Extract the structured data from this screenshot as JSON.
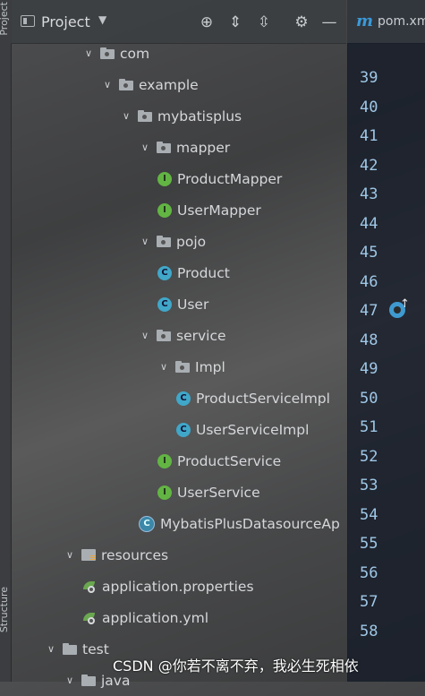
{
  "sidebar": {
    "top_label": "Project",
    "bottom_label": "Structure"
  },
  "project_panel": {
    "title": "Project"
  },
  "editor_tab": {
    "label": "pom.xml"
  },
  "tree": [
    {
      "label": "com",
      "kind": "package",
      "expanded": true
    },
    {
      "label": "example",
      "kind": "package",
      "expanded": true
    },
    {
      "label": "mybatisplus",
      "kind": "package",
      "expanded": true
    },
    {
      "label": "mapper",
      "kind": "package",
      "expanded": true
    },
    {
      "label": "ProductMapper",
      "kind": "interface"
    },
    {
      "label": "UserMapper",
      "kind": "interface"
    },
    {
      "label": "pojo",
      "kind": "package",
      "expanded": true
    },
    {
      "label": "Product",
      "kind": "class"
    },
    {
      "label": "User",
      "kind": "class"
    },
    {
      "label": "service",
      "kind": "package",
      "expanded": true
    },
    {
      "label": "Impl",
      "kind": "package",
      "expanded": true
    },
    {
      "label": "ProductServiceImpl",
      "kind": "class"
    },
    {
      "label": "UserServiceImpl",
      "kind": "class"
    },
    {
      "label": "ProductService",
      "kind": "interface"
    },
    {
      "label": "UserService",
      "kind": "interface"
    },
    {
      "label": "MybatisPlusDatasourceAp",
      "kind": "spring-boot-class"
    },
    {
      "label": "resources",
      "kind": "resources-folder",
      "expanded": true
    },
    {
      "label": "application.properties",
      "kind": "spring-config"
    },
    {
      "label": "application.yml",
      "kind": "spring-config"
    },
    {
      "label": "test",
      "kind": "folder",
      "expanded": true
    },
    {
      "label": "java",
      "kind": "folder",
      "expanded": true
    }
  ],
  "line_numbers": [
    "39",
    "40",
    "41",
    "42",
    "43",
    "44",
    "45",
    "46",
    "47",
    "48",
    "49",
    "50",
    "51",
    "52",
    "53",
    "54",
    "55",
    "56",
    "57",
    "58"
  ],
  "watermark": "CSDN @你若不离不弃，我必生死相依"
}
